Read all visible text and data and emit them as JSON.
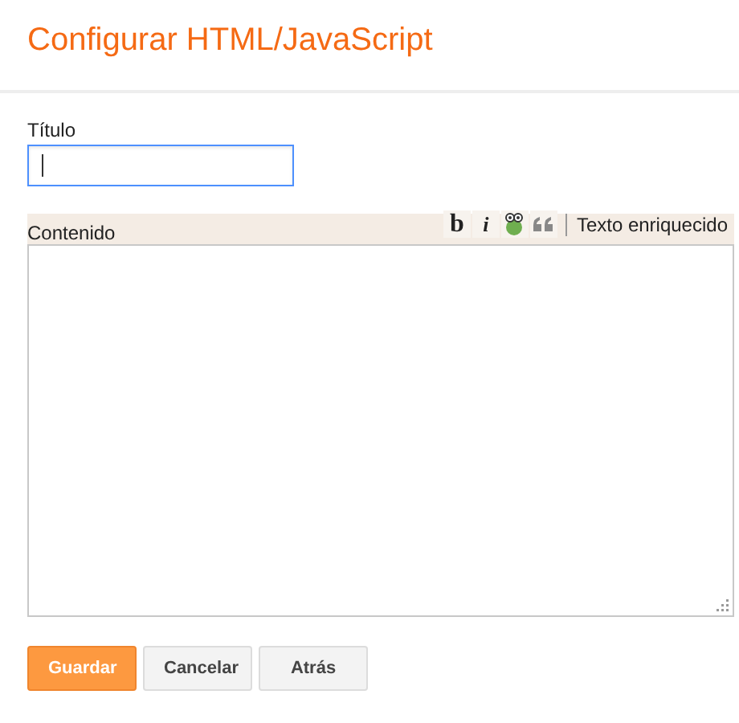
{
  "header": {
    "title": "Configurar HTML/JavaScript"
  },
  "title_field": {
    "label": "Título",
    "focused": true
  },
  "content": {
    "label": "Contenido",
    "toolbar": [
      {
        "kind": "bold",
        "text": "b"
      },
      {
        "kind": "italic",
        "text": "i"
      },
      {
        "kind": "frog"
      },
      {
        "kind": "quote"
      }
    ],
    "mode_link": "Texto enriquecido"
  },
  "buttons": [
    {
      "label": "Guardar",
      "kind": "primary"
    },
    {
      "label": "Cancelar",
      "kind": "secondary"
    },
    {
      "label": "Atrás",
      "kind": "secondary"
    }
  ]
}
